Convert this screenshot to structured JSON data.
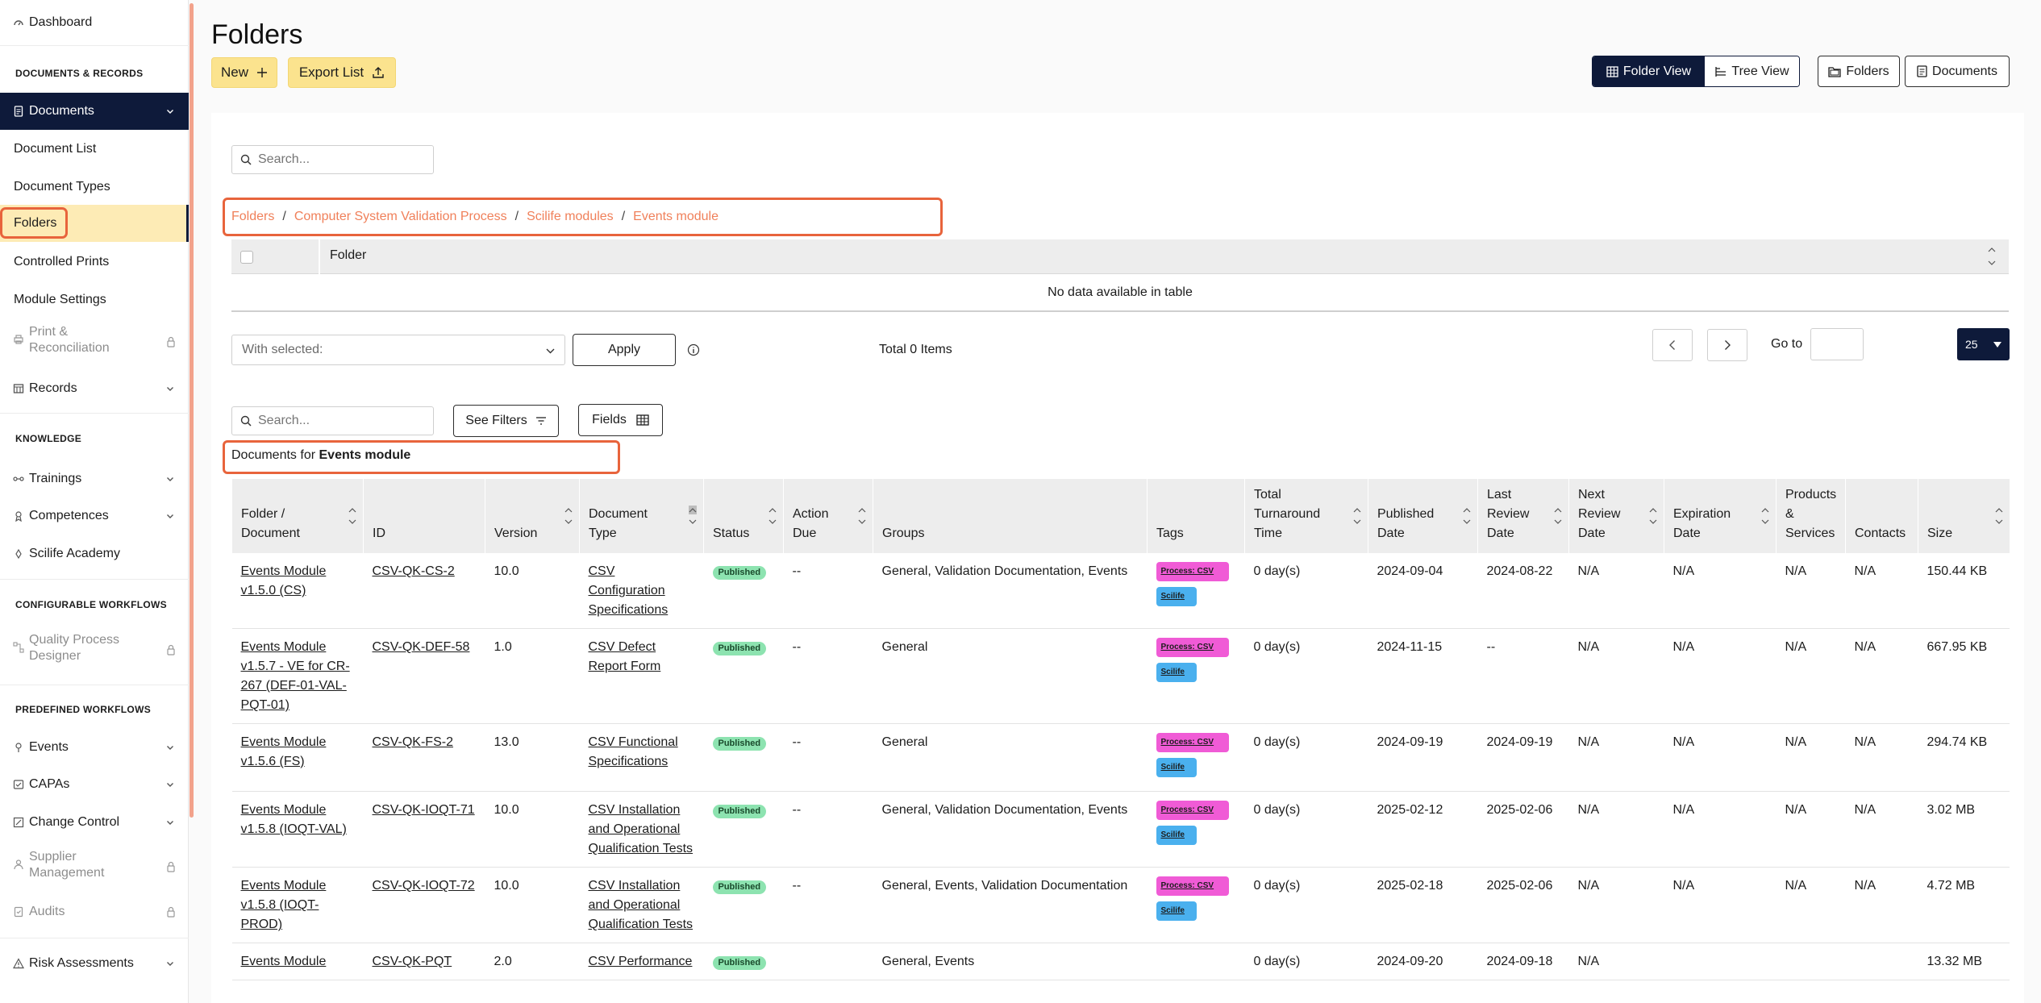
{
  "sidebar": {
    "dashboard": "Dashboard",
    "sections": {
      "documents_records": "DOCUMENTS & RECORDS",
      "knowledge": "KNOWLEDGE",
      "configurable_workflows": "CONFIGURABLE WORKFLOWS",
      "predefined_workflows": "PREDEFINED WORKFLOWS"
    },
    "documents": "Documents",
    "document_sub": {
      "document_list": "Document List",
      "document_types": "Document Types",
      "folders": "Folders",
      "controlled_prints": "Controlled Prints",
      "module_settings": "Module Settings"
    },
    "print_reconciliation_1": "Print &",
    "print_reconciliation_2": "Reconciliation",
    "records": "Records",
    "trainings": "Trainings",
    "competences": "Competences",
    "scilife_academy": "Scilife Academy",
    "quality_process_designer_1": "Quality Process",
    "quality_process_designer_2": "Designer",
    "events": "Events",
    "capas": "CAPAs",
    "change_control": "Change Control",
    "supplier_management_1": "Supplier",
    "supplier_management_2": "Management",
    "audits": "Audits",
    "risk_assessments": "Risk Assessments"
  },
  "page": {
    "title": "Folders",
    "new_label": "New",
    "export_label": "Export List",
    "folder_view": "Folder View",
    "tree_view": "Tree View",
    "folders_btn": "Folders",
    "documents_btn": "Documents"
  },
  "folder_panel": {
    "search_placeholder": "Search...",
    "breadcrumb": [
      "Folders",
      "Computer System Validation Process",
      "Scilife modules",
      "Events module"
    ],
    "column_folder": "Folder",
    "no_data": "No data available in table",
    "with_selected_placeholder": "With selected:",
    "apply": "Apply",
    "total_items": "Total 0 Items",
    "go_to": "Go to",
    "page_size": "25"
  },
  "documents_panel": {
    "search_placeholder": "Search...",
    "see_filters": "See Filters",
    "fields": "Fields",
    "documents_for_prefix": "Documents for",
    "documents_for_folder": "Events module",
    "columns": [
      [
        "Folder /",
        "Document"
      ],
      [
        "ID"
      ],
      [
        "Version"
      ],
      [
        "Document",
        "Type"
      ],
      [
        "Status"
      ],
      [
        "Action",
        "Due"
      ],
      [
        "Groups"
      ],
      [
        "Tags"
      ],
      [
        "Total",
        "Turnaround",
        "Time"
      ],
      [
        "Published",
        "Date"
      ],
      [
        "Last",
        "Review",
        "Date"
      ],
      [
        "Next",
        "Review",
        "Date"
      ],
      [
        "Expiration",
        "Date"
      ],
      [
        "Products",
        "&",
        "Services"
      ],
      [
        "Contacts"
      ],
      [
        "Size"
      ]
    ],
    "rows": [
      {
        "name": "Events Module v1.5.0 (CS)",
        "id": "CSV-QK-CS-2",
        "version": "10.0",
        "type": "CSV Configuration Specifications",
        "status": "Published",
        "action_due": "--",
        "groups": "General, Validation Documentation, Events",
        "tags": [
          "Process: CSV",
          "Scilife"
        ],
        "turnaround": "0 day(s)",
        "published": "2024-09-04",
        "last_review": "2024-08-22",
        "next_review": "N/A",
        "expiration": "N/A",
        "products": "N/A",
        "contacts": "N/A",
        "size": "150.44 KB"
      },
      {
        "name": "Events Module v1.5.7 - VE for CR-267 (DEF-01-VAL-PQT-01)",
        "id": "CSV-QK-DEF-58",
        "version": "1.0",
        "type": "CSV Defect Report Form",
        "status": "Published",
        "action_due": "--",
        "groups": "General",
        "tags": [
          "Process: CSV",
          "Scilife"
        ],
        "turnaround": "0 day(s)",
        "published": "2024-11-15",
        "last_review": "--",
        "next_review": "N/A",
        "expiration": "N/A",
        "products": "N/A",
        "contacts": "N/A",
        "size": "667.95 KB"
      },
      {
        "name": "Events Module v1.5.6 (FS)",
        "id": "CSV-QK-FS-2",
        "version": "13.0",
        "type": "CSV Functional Specifications",
        "status": "Published",
        "action_due": "--",
        "groups": "General",
        "tags": [
          "Process: CSV",
          "Scilife"
        ],
        "turnaround": "0 day(s)",
        "published": "2024-09-19",
        "last_review": "2024-09-19",
        "next_review": "N/A",
        "expiration": "N/A",
        "products": "N/A",
        "contacts": "N/A",
        "size": "294.74 KB"
      },
      {
        "name": "Events Module v1.5.8 (IOQT-VAL)",
        "id": "CSV-QK-IOQT-71",
        "version": "10.0",
        "type": "CSV Installation and Operational Qualification Tests",
        "status": "Published",
        "action_due": "--",
        "groups": "General, Validation Documentation, Events",
        "tags": [
          "Process: CSV",
          "Scilife"
        ],
        "turnaround": "0 day(s)",
        "published": "2025-02-12",
        "last_review": "2025-02-06",
        "next_review": "N/A",
        "expiration": "N/A",
        "products": "N/A",
        "contacts": "N/A",
        "size": "3.02 MB"
      },
      {
        "name": "Events Module v1.5.8 (IOQT-PROD)",
        "id": "CSV-QK-IOQT-72",
        "version": "10.0",
        "type": "CSV Installation and Operational Qualification Tests",
        "status": "Published",
        "action_due": "--",
        "groups": "General, Events, Validation Documentation",
        "tags": [
          "Process: CSV",
          "Scilife"
        ],
        "turnaround": "0 day(s)",
        "published": "2025-02-18",
        "last_review": "2025-02-06",
        "next_review": "N/A",
        "expiration": "N/A",
        "products": "N/A",
        "contacts": "N/A",
        "size": "4.72 MB"
      },
      {
        "name": "Events Module",
        "id": "CSV-QK-PQT",
        "version": "2.0",
        "type": "CSV Performance",
        "status": "Published",
        "action_due": "",
        "groups": "General, Events",
        "tags": [],
        "turnaround": "0 day(s)",
        "published": "2024-09-20",
        "last_review": "2024-09-18",
        "next_review": "N/A",
        "expiration": "",
        "products": "",
        "contacts": "",
        "size": "13.32 MB"
      }
    ]
  },
  "colors": {
    "nav_active": "#0e1a3a",
    "folders_active_bg": "#fdebb5",
    "highlight": "#e8643c",
    "accent_yellow": "#fbe38e",
    "tag_process": "#f05bd6",
    "tag_scilife": "#4ab0ee",
    "published": "#8de3b0"
  }
}
